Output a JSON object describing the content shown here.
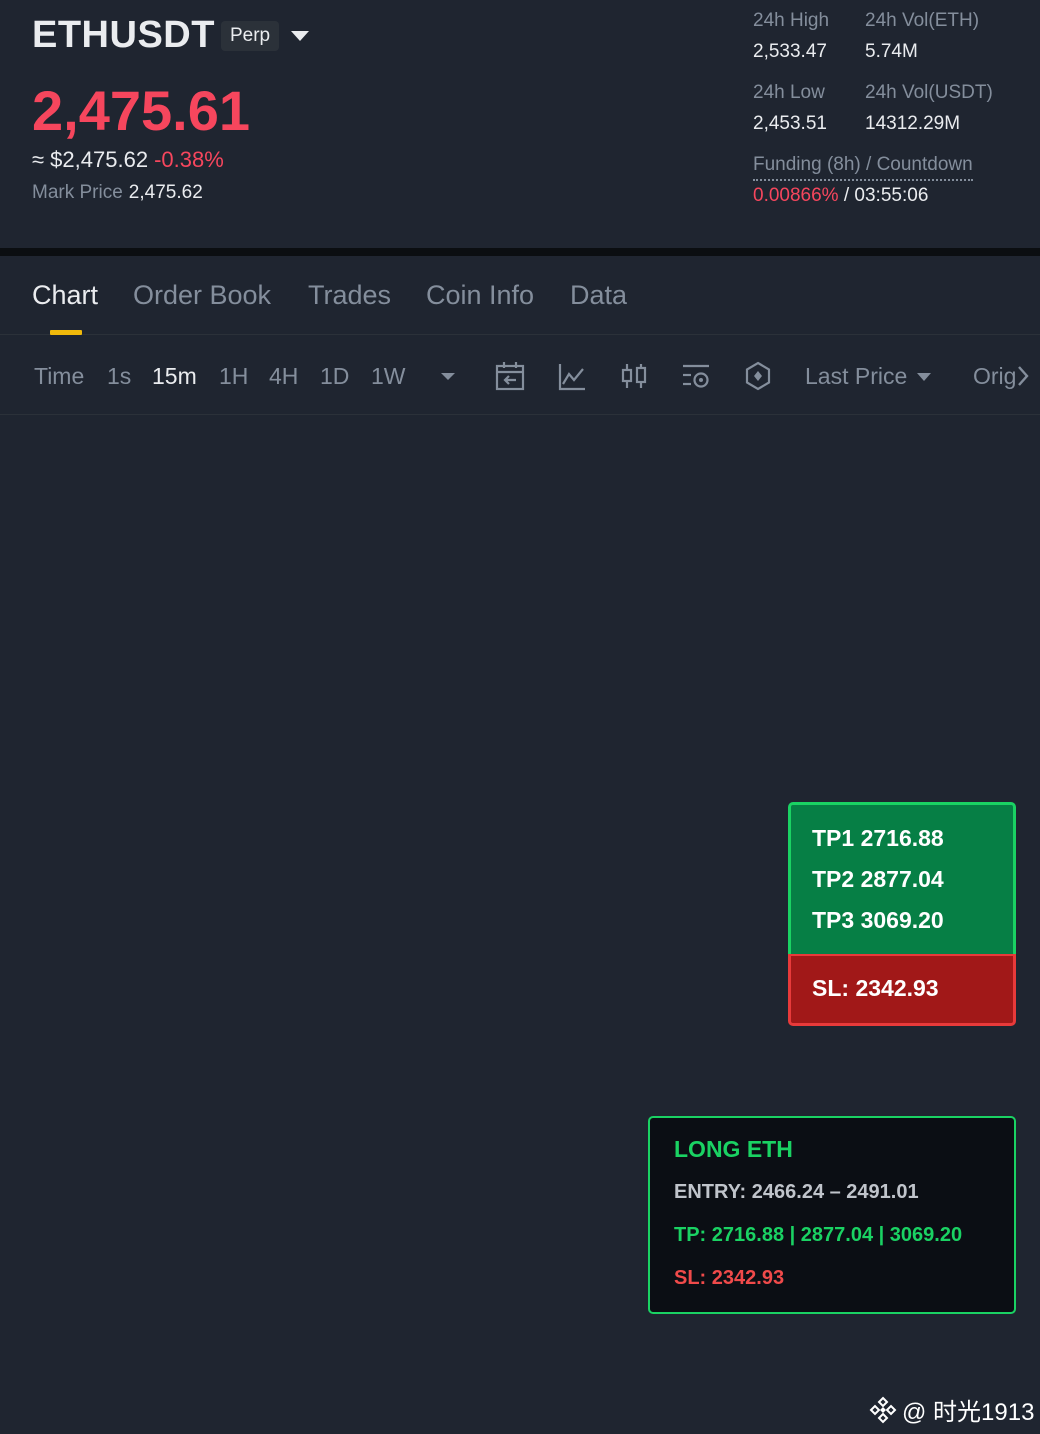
{
  "header": {
    "symbol": "ETHUSDT",
    "contract_badge": "Perp",
    "last_price": "2,475.61",
    "approx_price": "≈ $2,475.62",
    "change_pct": "-0.38%",
    "mark_price_label": "Mark Price",
    "mark_price": "2,475.62"
  },
  "stats": {
    "high_label": "24h High",
    "high": "2,533.47",
    "vol_eth_label": "24h Vol(ETH)",
    "vol_eth": "5.74M",
    "low_label": "24h Low",
    "low": "2,453.51",
    "vol_usdt_label": "24h Vol(USDT)",
    "vol_usdt": "14312.29M",
    "funding_label": "Funding (8h) / Countdown",
    "funding_rate": "0.00866%",
    "funding_sep": "/",
    "countdown": "03:55:06"
  },
  "tabs": [
    "Chart",
    "Order Book",
    "Trades",
    "Coin Info",
    "Data"
  ],
  "toolbar": {
    "timeframes": [
      "Time",
      "1s",
      "15m",
      "1H",
      "4H",
      "1D",
      "1W"
    ],
    "active_timeframe": "15m",
    "price_type": "Last Price",
    "orig_label": "Original"
  },
  "targets_box": {
    "tp1": "TP1 2716.88",
    "tp2": "TP2 2877.04",
    "tp3": "TP3 3069.20",
    "sl": "SL: 2342.93"
  },
  "signal": {
    "title": "LONG ETH",
    "entry": "ENTRY: 2466.24 – 2491.01",
    "tp": "TP: 2716.88 | 2877.04 | 3069.20",
    "sl": "SL: 2342.93"
  },
  "watermark": {
    "text": "@ 时光1913"
  },
  "colors": {
    "background": "#1f2530",
    "down_red": "#f6465d",
    "accent_yellow": "#f0b90b",
    "tp_green_fill": "#067f45",
    "tp_green_border": "#1ad263",
    "sl_red_fill": "#a11818"
  }
}
